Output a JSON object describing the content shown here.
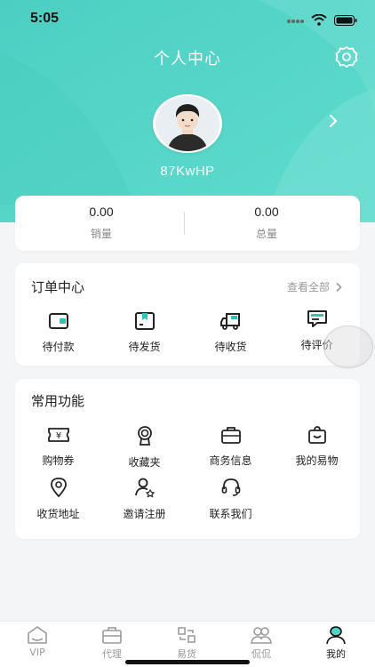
{
  "status_bar": {
    "time": "5:05"
  },
  "header": {
    "title": "个人中心",
    "username": "87KwHP"
  },
  "stats": [
    {
      "value": "0.00",
      "label": "销量"
    },
    {
      "value": "0.00",
      "label": "总量"
    }
  ],
  "orders": {
    "title": "订单中心",
    "view_all": "查看全部",
    "items": [
      {
        "label": "待付款",
        "icon": "wallet-icon"
      },
      {
        "label": "待发货",
        "icon": "package-icon"
      },
      {
        "label": "待收货",
        "icon": "truck-icon"
      },
      {
        "label": "待评价",
        "icon": "comment-icon"
      }
    ]
  },
  "functions": {
    "title": "常用功能",
    "items": [
      {
        "label": "购物券",
        "icon": "coupon-icon"
      },
      {
        "label": "收藏夹",
        "icon": "medal-icon"
      },
      {
        "label": "商务信息",
        "icon": "briefcase-icon"
      },
      {
        "label": "我的易物",
        "icon": "bag-icon"
      },
      {
        "label": "收货地址",
        "icon": "location-icon"
      },
      {
        "label": "邀请注册",
        "icon": "invite-user-icon"
      },
      {
        "label": "联系我们",
        "icon": "headset-icon"
      }
    ]
  },
  "tabbar": {
    "active": "我的",
    "items": [
      {
        "label": "VIP",
        "icon": "home-icon"
      },
      {
        "label": "代理",
        "icon": "briefcase-icon"
      },
      {
        "label": "易货",
        "icon": "exchange-icon"
      },
      {
        "label": "侃侃",
        "icon": "people-icon"
      },
      {
        "label": "我的",
        "icon": "user-icon"
      }
    ]
  },
  "colors": {
    "teal": "#4fd5c8",
    "teal_light": "#8fe6dc",
    "accent": "#27b9ad"
  }
}
